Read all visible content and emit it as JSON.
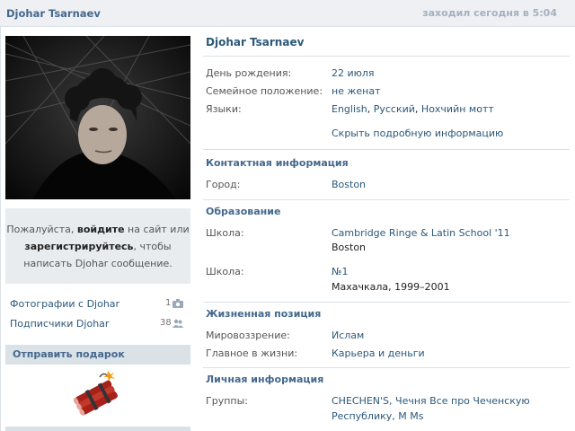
{
  "header": {
    "name": "Djohar Tsarnaev",
    "last_seen": "заходил сегодня в 5:04"
  },
  "sidebar": {
    "login_prompt": {
      "please": "Пожалуйста, ",
      "login": "войдите",
      "middle": " на сайт или",
      "register": "зарегистрируйтесь",
      "end": ", чтобы",
      "line3": "написать Djohar сообщение."
    },
    "photos": {
      "label": "Фотографии с Djohar",
      "count": "1"
    },
    "followers": {
      "label": "Подписчики Djohar",
      "count": "38"
    },
    "gift_button": "Отправить подарок"
  },
  "profile": {
    "name": "Djohar Tsarnaev",
    "birthday_label": "День рождения:",
    "birthday_value": "22 июля",
    "family_label": "Семейное положение:",
    "family_value": "не женат",
    "languages_label": "Языки:",
    "languages": [
      "English",
      "Русский",
      "Нохчийн мотт"
    ],
    "hide_info": "Скрыть подробную информацию",
    "contact_title": "Контактная информация",
    "city_label": "Город:",
    "city_value": "Boston",
    "education_title": "Образование",
    "school1_label": "Школа:",
    "school1_name": "Cambridge Ringe & Latin School '11",
    "school1_city": "Boston",
    "school2_label": "Школа:",
    "school2_name": "№1",
    "school2_city": "Махачкала, 1999–2001",
    "position_title": "Жизненная позиция",
    "worldview_label": "Мировоззрение:",
    "worldview_value": "Ислам",
    "main_label": "Главное в жизни:",
    "main_value": "Карьера и деньги",
    "personal_title": "Личная информация",
    "groups_label": "Группы:",
    "groups_line1": "CHECHEN'S, Чечня Все про Чеченскую",
    "groups_line2": "Республику, M Ms"
  }
}
